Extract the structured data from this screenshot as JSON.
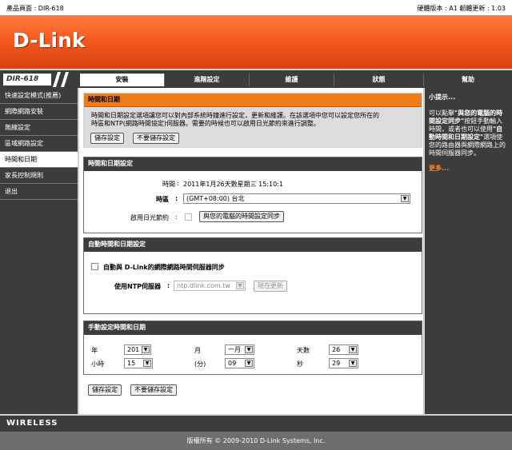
{
  "header": {
    "product_label": "產品頁面 : DIR-618",
    "version_label": "硬體版本 : A1   韌體更新 : 1.03"
  },
  "brand": {
    "logo_text": "D-Link",
    "model": "DIR-618"
  },
  "tabs": [
    {
      "label": "安裝"
    },
    {
      "label": "進階設定"
    },
    {
      "label": "維護"
    },
    {
      "label": "狀態"
    },
    {
      "label": "幫助"
    }
  ],
  "sidebar": {
    "items": [
      {
        "label": "快速設定模式(推薦)"
      },
      {
        "label": "網際網路安裝"
      },
      {
        "label": "無線設定"
      },
      {
        "label": "區域網路設定"
      },
      {
        "label": "時間和日期"
      },
      {
        "label": "家長控制規則"
      },
      {
        "label": "退出"
      }
    ]
  },
  "intro": {
    "title": "時間和日期",
    "desc_line1": "時間和日期設定選項讓您可以對內部系統時鐘進行設定，更新和維護。在該選項中您可以設定您所在的",
    "desc_line2": "時區和NTP(網路時間協定)伺服器。需要的時候也可以啟用日光節約來進行調整。",
    "save": "儲存設定",
    "dont_save": "不要儲存設定"
  },
  "time_config": {
    "title": "時間和日期設定",
    "time_label": "時間",
    "time_value": "2011年1月26天數星期三  15:10:1",
    "tz_label": "時區",
    "tz_value": "(GMT+08:00) 台北",
    "dst_label": "啟用日光節約",
    "sync_button": "與您的電腦的時間設定同步"
  },
  "auto_config": {
    "title": "自動時間和日期設定",
    "checkbox_label": "自動與 D-Link的網際網路時間伺服器同步",
    "ntp_label": "使用NTP伺服器",
    "ntp_value": "ntp.dlink.com.tw",
    "update_button": "現在更新"
  },
  "manual_config": {
    "title": "手動設定時間和日期",
    "year_label": "年",
    "year_value": "201",
    "month_label": "月",
    "month_value": "一月",
    "day_label": "天數",
    "day_value": "26",
    "hour_label": "小時",
    "hour_value": "15",
    "minute_label": "(分)",
    "minute_value": "09",
    "second_label": "秒",
    "second_value": "29"
  },
  "bottom_buttons": {
    "save": "儲存設定",
    "dont_save": "不要儲存設定"
  },
  "help": {
    "title": "小提示...",
    "text_a": "可以點擊",
    "text_b": "\"與您的電腦的時間設定同步\"",
    "text_c": "按鈕手動輸入時間，或者也可以使用",
    "text_d": "\"自動時間和日期設定\"",
    "text_e": "選項使您的路由器與網際網路上的時間伺服器同步。",
    "more": "更多..."
  },
  "footer": {
    "wireless": "WIRELESS",
    "copyright": "版權所有 © 2009-2010 D-Link Systems, Inc."
  },
  "colors": {
    "brand_orange": "#f0541c",
    "panel_dark": "#3c3c3c",
    "section_orange": "#f07d1c"
  }
}
